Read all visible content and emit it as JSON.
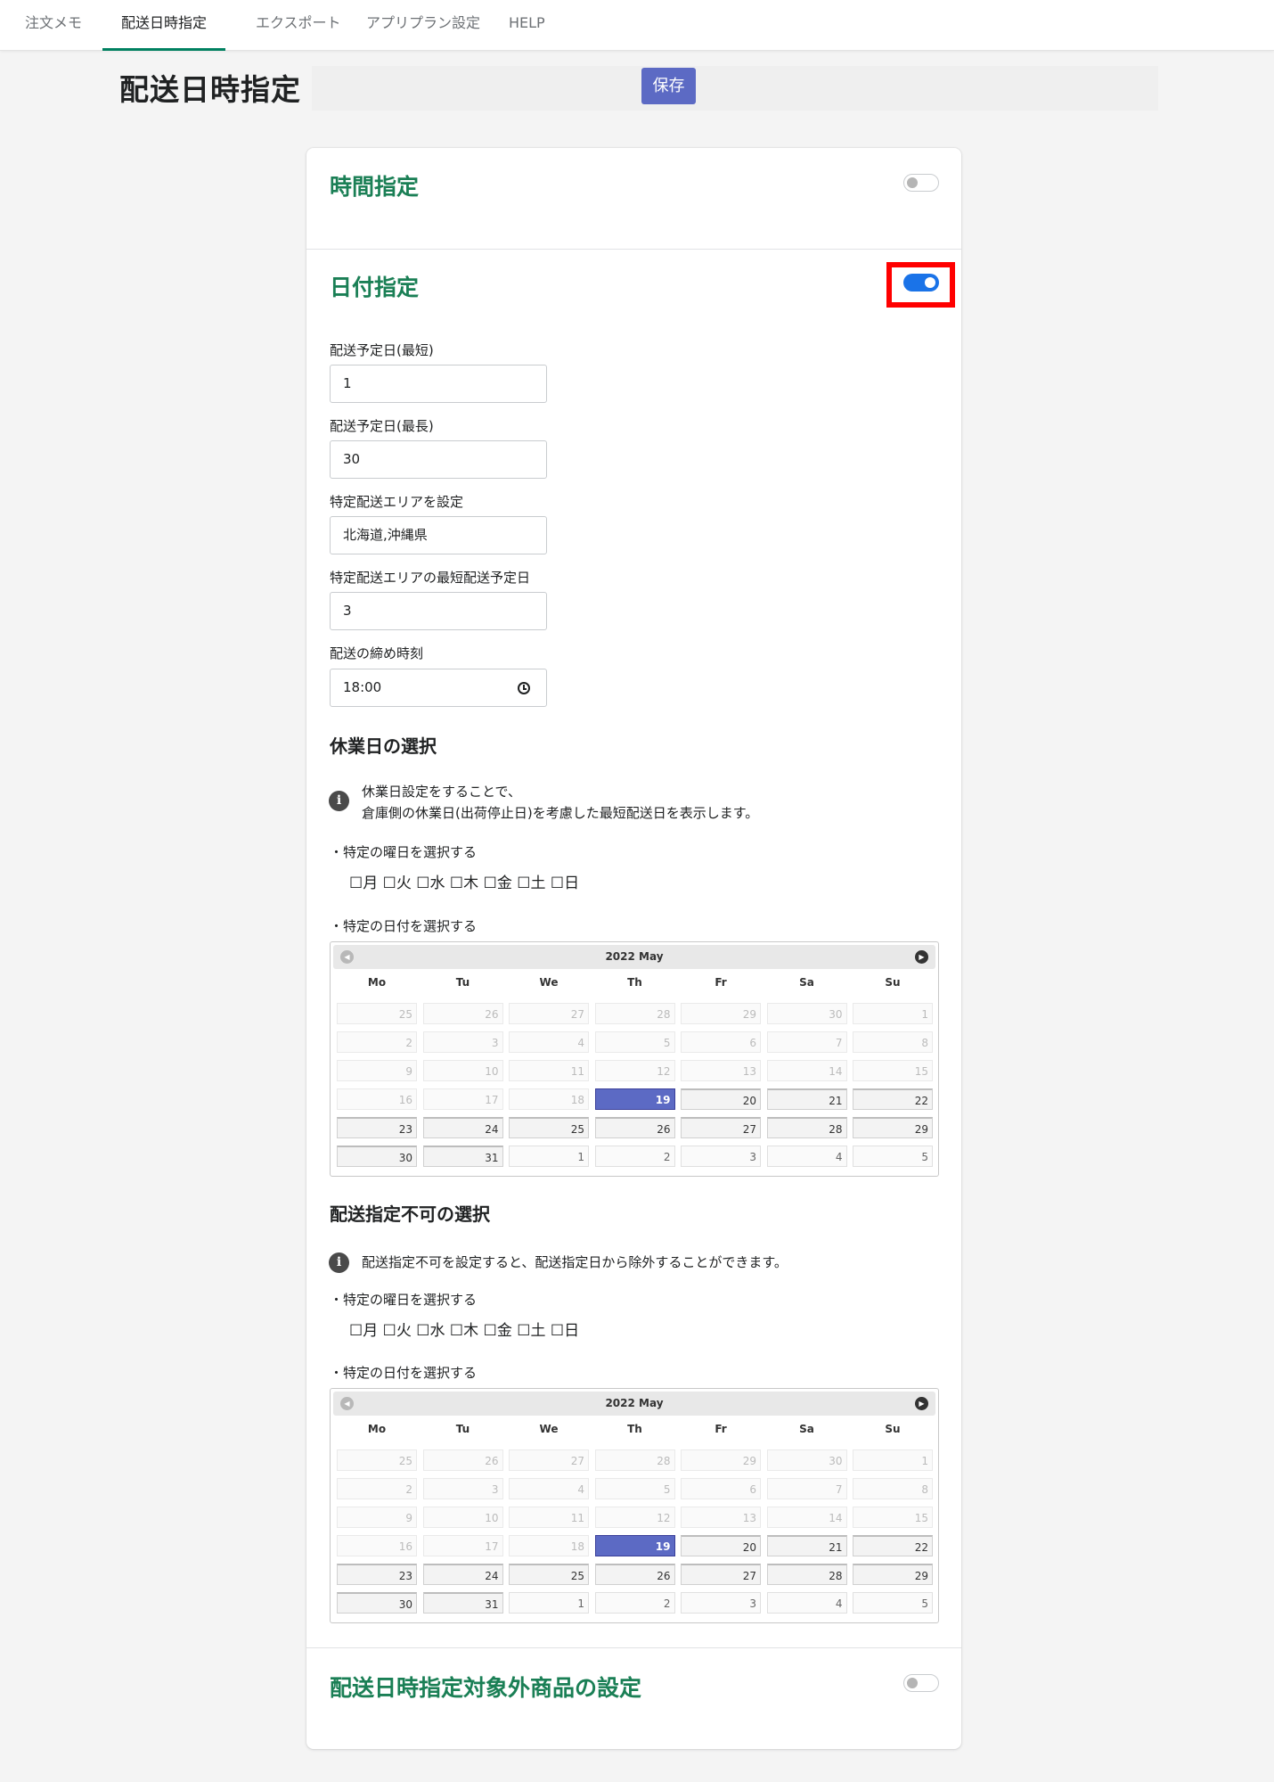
{
  "tabs": [
    "注文メモ",
    "配送日時指定",
    "エクスポート",
    "アプリプラン設定",
    "HELP"
  ],
  "page": {
    "title": "配送日時指定",
    "save_label": "保存"
  },
  "sections": {
    "time": {
      "title": "時間指定",
      "enabled": false
    },
    "date": {
      "title": "日付指定",
      "enabled": true
    },
    "exclude": {
      "title": "配送日時指定対象外商品の設定",
      "enabled": false
    }
  },
  "fields": {
    "min_label": "配送予定日(最短)",
    "min_value": "1",
    "max_label": "配送予定日(最長)",
    "max_value": "30",
    "area_label": "特定配送エリアを設定",
    "area_value": "北海道,沖縄県",
    "area_min_label": "特定配送エリアの最短配送予定日",
    "area_min_value": "3",
    "cutoff_label": "配送の締め時刻",
    "cutoff_value": "18:00"
  },
  "holidays": {
    "title": "休業日の選択",
    "info_line1": "休業日設定をすることで、",
    "info_line2": "倉庫側の休業日(出荷停止日)を考慮した最短配送日を表示します。",
    "weekday_label": "・特定の曜日を選択する",
    "weekdays": "☐月 ☐火 ☐水 ☐木 ☐金 ☐土 ☐日",
    "date_label": "・特定の日付を選択する"
  },
  "blocked": {
    "title": "配送指定不可の選択",
    "info_line1": "配送指定不可を設定すると、配送指定日から除外することができます。",
    "weekday_label": "・特定の曜日を選択する",
    "weekdays": "☐月 ☐火 ☐水 ☐木 ☐金 ☐土 ☐日",
    "date_label": "・特定の日付を選択する"
  },
  "calendar": {
    "title": "2022 May",
    "dow": [
      "Mo",
      "Tu",
      "We",
      "Th",
      "Fr",
      "Sa",
      "Su"
    ],
    "weeks": [
      [
        [
          "25",
          "dis"
        ],
        [
          "26",
          "dis"
        ],
        [
          "27",
          "dis"
        ],
        [
          "28",
          "dis"
        ],
        [
          "29",
          "dis"
        ],
        [
          "30",
          "dis"
        ],
        [
          "1",
          "dis"
        ]
      ],
      [
        [
          "2",
          "dis"
        ],
        [
          "3",
          "dis"
        ],
        [
          "4",
          "dis"
        ],
        [
          "5",
          "dis"
        ],
        [
          "6",
          "dis"
        ],
        [
          "7",
          "dis"
        ],
        [
          "8",
          "dis"
        ]
      ],
      [
        [
          "9",
          "dis"
        ],
        [
          "10",
          "dis"
        ],
        [
          "11",
          "dis"
        ],
        [
          "12",
          "dis"
        ],
        [
          "13",
          "dis"
        ],
        [
          "14",
          "dis"
        ],
        [
          "15",
          "dis"
        ]
      ],
      [
        [
          "16",
          "dis"
        ],
        [
          "17",
          "dis"
        ],
        [
          "18",
          "dis"
        ],
        [
          "19",
          "today"
        ],
        [
          "20",
          "act"
        ],
        [
          "21",
          "act"
        ],
        [
          "22",
          "act"
        ]
      ],
      [
        [
          "23",
          "act"
        ],
        [
          "24",
          "act"
        ],
        [
          "25",
          "act"
        ],
        [
          "26",
          "act"
        ],
        [
          "27",
          "act"
        ],
        [
          "28",
          "act"
        ],
        [
          "29",
          "act"
        ]
      ],
      [
        [
          "30",
          "act"
        ],
        [
          "31",
          "act"
        ],
        [
          "1",
          "next"
        ],
        [
          "2",
          "next"
        ],
        [
          "3",
          "next"
        ],
        [
          "4",
          "next"
        ],
        [
          "5",
          "next"
        ]
      ]
    ]
  }
}
